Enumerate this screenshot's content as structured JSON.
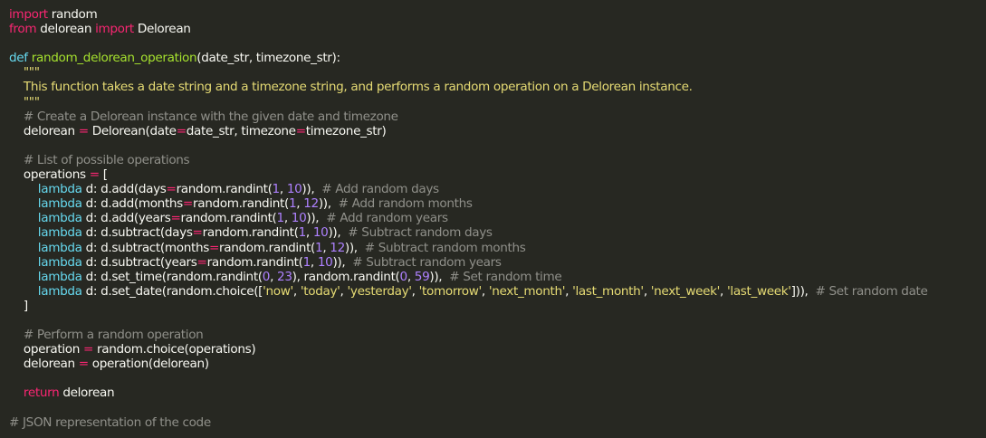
{
  "code": {
    "lines": [
      [
        {
          "t": "import",
          "c": "kw"
        },
        {
          "t": " random",
          "c": "plain"
        }
      ],
      [
        {
          "t": "from",
          "c": "kw"
        },
        {
          "t": " delorean ",
          "c": "plain"
        },
        {
          "t": "import",
          "c": "kw"
        },
        {
          "t": " Delorean",
          "c": "plain"
        }
      ],
      [],
      [
        {
          "t": "def",
          "c": "def"
        },
        {
          "t": " ",
          "c": "plain"
        },
        {
          "t": "random_delorean_operation",
          "c": "fn"
        },
        {
          "t": "(date_str, timezone_str):",
          "c": "plain"
        }
      ],
      [
        {
          "t": "    \"\"\"",
          "c": "str"
        }
      ],
      [
        {
          "t": "    This function takes a date string and a timezone string, and performs a random operation on a Delorean instance.",
          "c": "str"
        }
      ],
      [
        {
          "t": "    \"\"\"",
          "c": "str"
        }
      ],
      [
        {
          "t": "    # Create a Delorean instance with the given date and timezone",
          "c": "cm"
        }
      ],
      [
        {
          "t": "    delorean ",
          "c": "plain"
        },
        {
          "t": "=",
          "c": "op"
        },
        {
          "t": " Delorean(date",
          "c": "plain"
        },
        {
          "t": "=",
          "c": "op"
        },
        {
          "t": "date_str, timezone",
          "c": "plain"
        },
        {
          "t": "=",
          "c": "op"
        },
        {
          "t": "timezone_str)",
          "c": "plain"
        }
      ],
      [],
      [
        {
          "t": "    # List of possible operations",
          "c": "cm"
        }
      ],
      [
        {
          "t": "    operations ",
          "c": "plain"
        },
        {
          "t": "=",
          "c": "op"
        },
        {
          "t": " [",
          "c": "plain"
        }
      ],
      [
        {
          "t": "        ",
          "c": "plain"
        },
        {
          "t": "lambda",
          "c": "lam"
        },
        {
          "t": " d: d.add(days",
          "c": "plain"
        },
        {
          "t": "=",
          "c": "op"
        },
        {
          "t": "random.randint(",
          "c": "plain"
        },
        {
          "t": "1",
          "c": "num"
        },
        {
          "t": ", ",
          "c": "plain"
        },
        {
          "t": "10",
          "c": "num"
        },
        {
          "t": ")),  ",
          "c": "plain"
        },
        {
          "t": "# Add random days",
          "c": "cm"
        }
      ],
      [
        {
          "t": "        ",
          "c": "plain"
        },
        {
          "t": "lambda",
          "c": "lam"
        },
        {
          "t": " d: d.add(months",
          "c": "plain"
        },
        {
          "t": "=",
          "c": "op"
        },
        {
          "t": "random.randint(",
          "c": "plain"
        },
        {
          "t": "1",
          "c": "num"
        },
        {
          "t": ", ",
          "c": "plain"
        },
        {
          "t": "12",
          "c": "num"
        },
        {
          "t": ")),  ",
          "c": "plain"
        },
        {
          "t": "# Add random months",
          "c": "cm"
        }
      ],
      [
        {
          "t": "        ",
          "c": "plain"
        },
        {
          "t": "lambda",
          "c": "lam"
        },
        {
          "t": " d: d.add(years",
          "c": "plain"
        },
        {
          "t": "=",
          "c": "op"
        },
        {
          "t": "random.randint(",
          "c": "plain"
        },
        {
          "t": "1",
          "c": "num"
        },
        {
          "t": ", ",
          "c": "plain"
        },
        {
          "t": "10",
          "c": "num"
        },
        {
          "t": ")),  ",
          "c": "plain"
        },
        {
          "t": "# Add random years",
          "c": "cm"
        }
      ],
      [
        {
          "t": "        ",
          "c": "plain"
        },
        {
          "t": "lambda",
          "c": "lam"
        },
        {
          "t": " d: d.subtract(days",
          "c": "plain"
        },
        {
          "t": "=",
          "c": "op"
        },
        {
          "t": "random.randint(",
          "c": "plain"
        },
        {
          "t": "1",
          "c": "num"
        },
        {
          "t": ", ",
          "c": "plain"
        },
        {
          "t": "10",
          "c": "num"
        },
        {
          "t": ")),  ",
          "c": "plain"
        },
        {
          "t": "# Subtract random days",
          "c": "cm"
        }
      ],
      [
        {
          "t": "        ",
          "c": "plain"
        },
        {
          "t": "lambda",
          "c": "lam"
        },
        {
          "t": " d: d.subtract(months",
          "c": "plain"
        },
        {
          "t": "=",
          "c": "op"
        },
        {
          "t": "random.randint(",
          "c": "plain"
        },
        {
          "t": "1",
          "c": "num"
        },
        {
          "t": ", ",
          "c": "plain"
        },
        {
          "t": "12",
          "c": "num"
        },
        {
          "t": ")),  ",
          "c": "plain"
        },
        {
          "t": "# Subtract random months",
          "c": "cm"
        }
      ],
      [
        {
          "t": "        ",
          "c": "plain"
        },
        {
          "t": "lambda",
          "c": "lam"
        },
        {
          "t": " d: d.subtract(years",
          "c": "plain"
        },
        {
          "t": "=",
          "c": "op"
        },
        {
          "t": "random.randint(",
          "c": "plain"
        },
        {
          "t": "1",
          "c": "num"
        },
        {
          "t": ", ",
          "c": "plain"
        },
        {
          "t": "10",
          "c": "num"
        },
        {
          "t": ")),  ",
          "c": "plain"
        },
        {
          "t": "# Subtract random years",
          "c": "cm"
        }
      ],
      [
        {
          "t": "        ",
          "c": "plain"
        },
        {
          "t": "lambda",
          "c": "lam"
        },
        {
          "t": " d: d.set_time(random.randint(",
          "c": "plain"
        },
        {
          "t": "0",
          "c": "num"
        },
        {
          "t": ", ",
          "c": "plain"
        },
        {
          "t": "23",
          "c": "num"
        },
        {
          "t": "), random.randint(",
          "c": "plain"
        },
        {
          "t": "0",
          "c": "num"
        },
        {
          "t": ", ",
          "c": "plain"
        },
        {
          "t": "59",
          "c": "num"
        },
        {
          "t": ")),  ",
          "c": "plain"
        },
        {
          "t": "# Set random time",
          "c": "cm"
        }
      ],
      [
        {
          "t": "        ",
          "c": "plain"
        },
        {
          "t": "lambda",
          "c": "lam"
        },
        {
          "t": " d: d.set_date(random.choice([",
          "c": "plain"
        },
        {
          "t": "'now'",
          "c": "str"
        },
        {
          "t": ", ",
          "c": "plain"
        },
        {
          "t": "'today'",
          "c": "str"
        },
        {
          "t": ", ",
          "c": "plain"
        },
        {
          "t": "'yesterday'",
          "c": "str"
        },
        {
          "t": ", ",
          "c": "plain"
        },
        {
          "t": "'tomorrow'",
          "c": "str"
        },
        {
          "t": ", ",
          "c": "plain"
        },
        {
          "t": "'next_month'",
          "c": "str"
        },
        {
          "t": ", ",
          "c": "plain"
        },
        {
          "t": "'last_month'",
          "c": "str"
        },
        {
          "t": ", ",
          "c": "plain"
        },
        {
          "t": "'next_week'",
          "c": "str"
        },
        {
          "t": ", ",
          "c": "plain"
        },
        {
          "t": "'last_week'",
          "c": "str"
        },
        {
          "t": "])),  ",
          "c": "plain"
        },
        {
          "t": "# Set random date",
          "c": "cm"
        }
      ],
      [
        {
          "t": "    ]",
          "c": "plain"
        }
      ],
      [],
      [
        {
          "t": "    # Perform a random operation",
          "c": "cm"
        }
      ],
      [
        {
          "t": "    operation ",
          "c": "plain"
        },
        {
          "t": "=",
          "c": "op"
        },
        {
          "t": " random.choice(operations)",
          "c": "plain"
        }
      ],
      [
        {
          "t": "    delorean ",
          "c": "plain"
        },
        {
          "t": "=",
          "c": "op"
        },
        {
          "t": " operation(delorean)",
          "c": "plain"
        }
      ],
      [],
      [
        {
          "t": "    ",
          "c": "plain"
        },
        {
          "t": "return",
          "c": "kw"
        },
        {
          "t": " delorean",
          "c": "plain"
        }
      ],
      [],
      [
        {
          "t": "# JSON representation of the code",
          "c": "cm"
        }
      ]
    ]
  },
  "theme": {
    "background": "#272822",
    "foreground": "#f8f8f2",
    "keyword": "#f92672",
    "storage": "#66d9ef",
    "function": "#a6e22e",
    "string": "#e6db74",
    "number": "#ae81ff",
    "comment": "#90908a"
  }
}
